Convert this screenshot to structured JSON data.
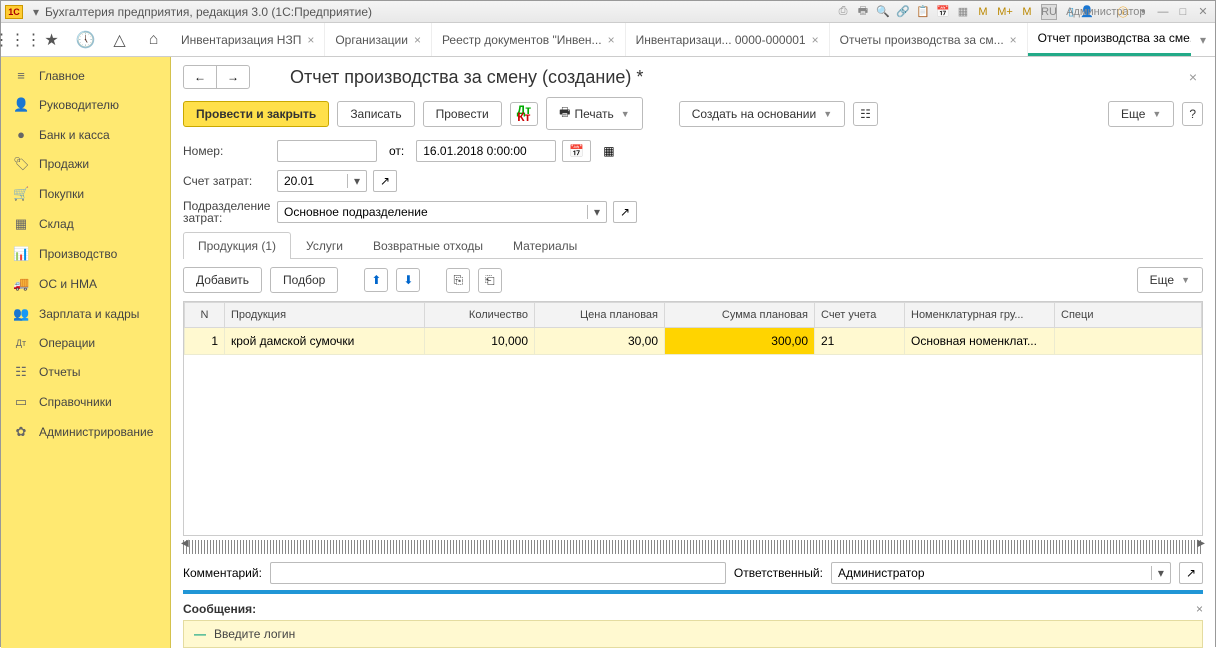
{
  "titlebar": {
    "logo": "1C",
    "title": "Бухгалтерия предприятия, редакция 3.0  (1С:Предприятие)",
    "lang": "RU",
    "user": "Администратор",
    "m_labels": [
      "M",
      "M+",
      "M"
    ]
  },
  "tabs": [
    {
      "label": "Инвентаризация НЗП"
    },
    {
      "label": "Организации"
    },
    {
      "label": "Реестр документов \"Инвен..."
    },
    {
      "label": "Инвентаризаци... 0000-000001"
    },
    {
      "label": "Отчеты производства за см..."
    },
    {
      "label": "Отчет производства за сме...",
      "active": true
    }
  ],
  "sidebar": [
    {
      "icon": "≡",
      "label": "Главное"
    },
    {
      "icon": "👤",
      "label": "Руководителю"
    },
    {
      "icon": "●",
      "label": "Банк и касса"
    },
    {
      "icon": "🏷",
      "label": "Продажи"
    },
    {
      "icon": "🛒",
      "label": "Покупки"
    },
    {
      "icon": "▦",
      "label": "Склад"
    },
    {
      "icon": "📊",
      "label": "Производство"
    },
    {
      "icon": "🚚",
      "label": "ОС и НМА"
    },
    {
      "icon": "👥",
      "label": "Зарплата и кадры"
    },
    {
      "icon": "Дт",
      "label": "Операции"
    },
    {
      "icon": "☷",
      "label": "Отчеты"
    },
    {
      "icon": "▭",
      "label": "Справочники"
    },
    {
      "icon": "✿",
      "label": "Администрирование"
    }
  ],
  "doc": {
    "title": "Отчет производства за смену (создание) *",
    "buttons": {
      "provesti_zakryt": "Провести и закрыть",
      "zapisat": "Записать",
      "provesti": "Провести",
      "pechat": "Печать",
      "sozdat": "Создать на основании",
      "eshe": "Еще",
      "help": "?"
    },
    "labels": {
      "nomer": "Номер:",
      "ot": "от:",
      "schet": "Счет затрат:",
      "podrazd": "Подразделение затрат:",
      "comment": "Комментарий:",
      "otvet": "Ответственный:"
    },
    "values": {
      "nomer": "",
      "date": "16.01.2018  0:00:00",
      "schet": "20.01",
      "podrazd": "Основное подразделение",
      "comment": "",
      "otvet": "Администратор"
    },
    "subtabs": [
      "Продукция (1)",
      "Услуги",
      "Возвратные отходы",
      "Материалы"
    ],
    "table": {
      "buttons": {
        "add": "Добавить",
        "podbor": "Подбор",
        "eshe": "Еще"
      },
      "headers": [
        "N",
        "Продукция",
        "Количество",
        "Цена плановая",
        "Сумма плановая",
        "Счет учета",
        "Номенклатурная гру...",
        "Специ"
      ],
      "rows": [
        {
          "n": "1",
          "prod": "крой дамской сумочки",
          "qty": "10,000",
          "price": "30,00",
          "sum": "300,00",
          "acct": "21",
          "nom": "Основная номенклат...",
          "spec": ""
        }
      ]
    },
    "messages": {
      "title": "Сообщения:",
      "item": "Введите логин"
    }
  }
}
